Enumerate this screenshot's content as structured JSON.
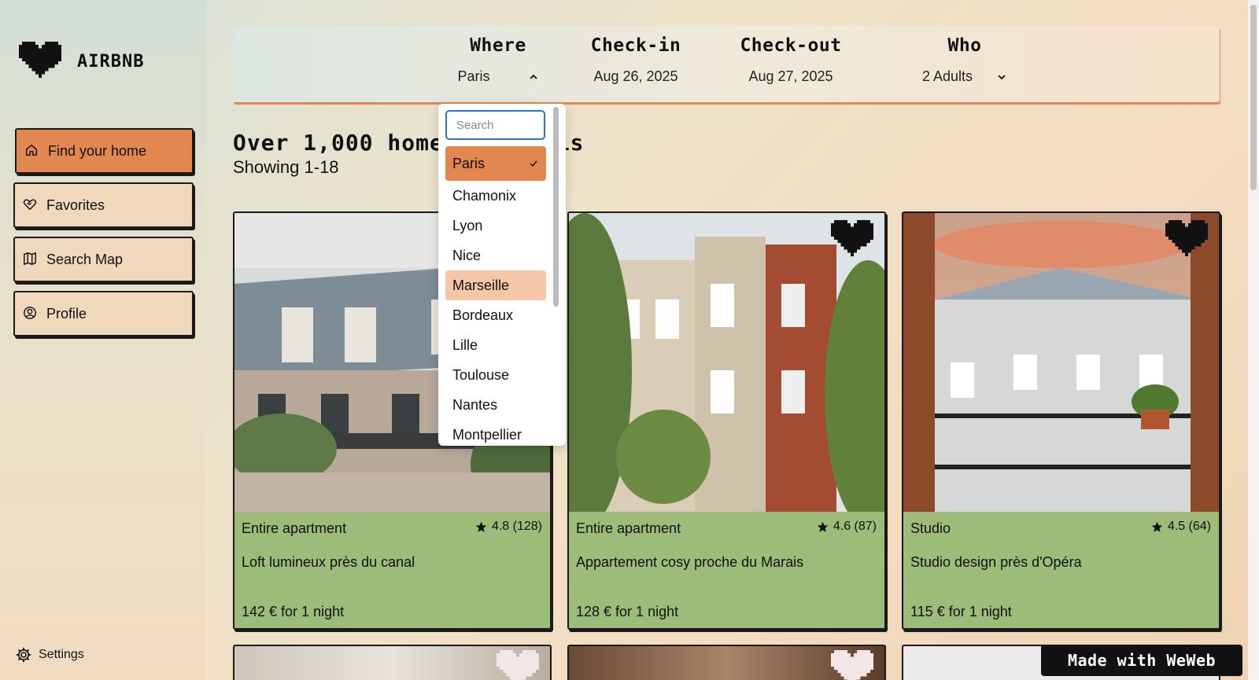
{
  "brand": {
    "name": "AIRBNB",
    "logo_icon": "pixel-heart-icon"
  },
  "sidebar": {
    "items": [
      {
        "label": "Find your home",
        "icon": "home-icon",
        "active": true
      },
      {
        "label": "Favorites",
        "icon": "heart-handshake-icon",
        "active": false
      },
      {
        "label": "Search Map",
        "icon": "map-icon",
        "active": false
      },
      {
        "label": "Profile",
        "icon": "user-circle-icon",
        "active": false
      }
    ],
    "settings_label": "Settings"
  },
  "search": {
    "where": {
      "label": "Where",
      "value": "Paris"
    },
    "checkin": {
      "label": "Check-in",
      "value": "Aug 26, 2025"
    },
    "checkout": {
      "label": "Check-out",
      "value": "Aug 27, 2025"
    },
    "who": {
      "label": "Who",
      "value": "2 Adults"
    }
  },
  "results": {
    "heading": "Over 1,000 homes in Paris",
    "showing": "Showing 1-18"
  },
  "dropdown": {
    "placeholder": "Search",
    "options": [
      "Paris",
      "Chamonix",
      "Lyon",
      "Nice",
      "Marseille",
      "Bordeaux",
      "Lille",
      "Toulouse",
      "Nantes",
      "Montpellier"
    ],
    "selected": "Paris",
    "hovered": "Marseille"
  },
  "listings": [
    {
      "type": "Entire apartment",
      "rating": "4.8 (128)",
      "title": "Loft lumineux près du canal",
      "price": "142 € for 1 night"
    },
    {
      "type": "Entire apartment",
      "rating": "4.6 (87)",
      "title": "Appartement cosy proche du Marais",
      "price": "128 € for 1 night"
    },
    {
      "type": "Studio",
      "rating": "4.5 (64)",
      "title": "Studio design près d'Opéra",
      "price": "115 € for 1 night"
    }
  ],
  "badge": "Made with WeWeb",
  "colors": {
    "accent": "#e2874f",
    "card_info": "#9dbb79",
    "hover": "#f4c7a9",
    "focus": "#2f6fd3"
  }
}
